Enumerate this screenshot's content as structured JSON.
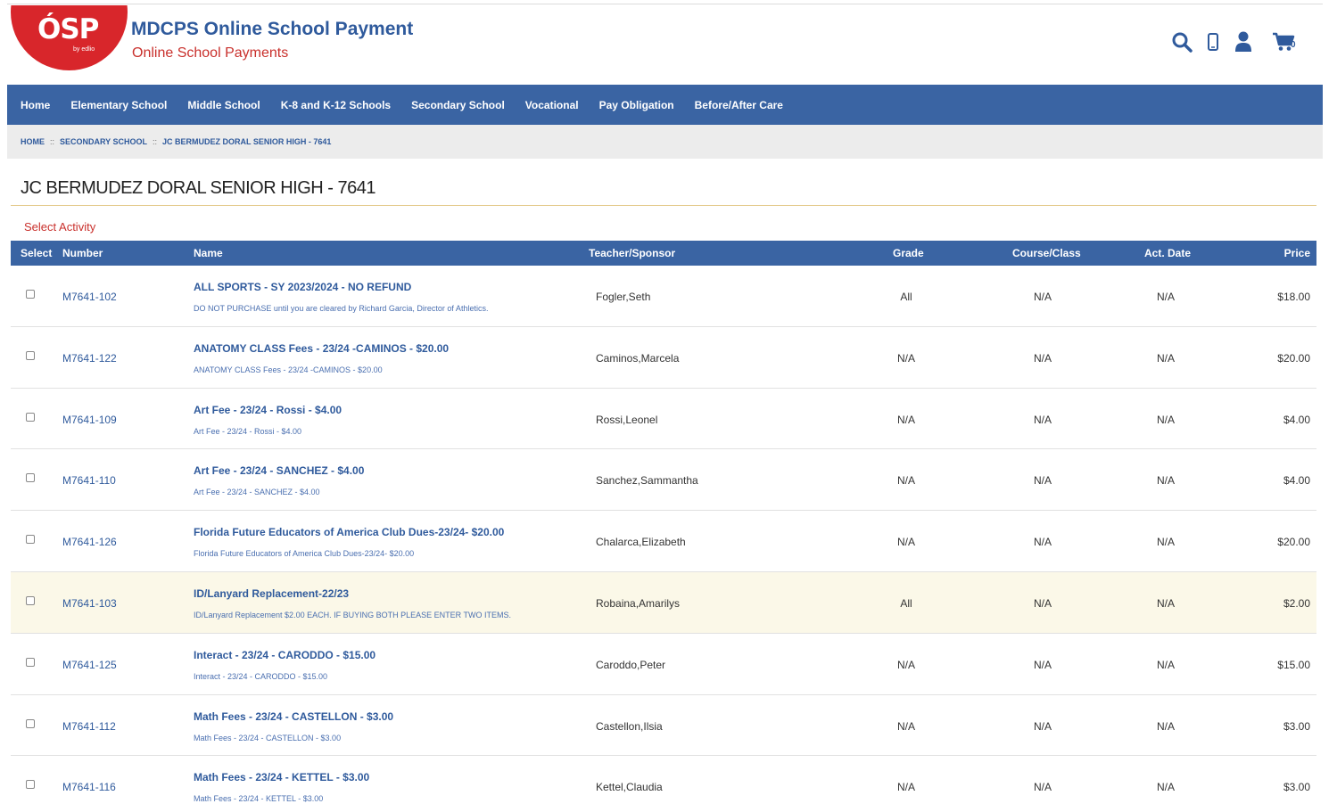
{
  "header": {
    "logo_text": "ÓSP",
    "logo_subtext": "by edlio",
    "title": "MDCPS Online School Payment",
    "subtitle": "Online School Payments",
    "cart_count": "0",
    "icons": [
      "search-icon",
      "phone-icon",
      "user-icon",
      "cart-icon"
    ]
  },
  "nav": {
    "items": [
      "Home",
      "Elementary School",
      "Middle School",
      "K-8 and K-12 Schools",
      "Secondary School",
      "Vocational",
      "Pay Obligation",
      "Before/After Care"
    ]
  },
  "breadcrumb": [
    "HOME",
    "SECONDARY SCHOOL",
    "JC BERMUDEZ DORAL SENIOR HIGH - 7641"
  ],
  "breadcrumb_separator": "::",
  "page_title": "JC BERMUDEZ DORAL SENIOR HIGH - 7641",
  "section_label": "Select Activity",
  "table": {
    "headers": [
      "Select",
      "Number",
      "Name",
      "Teacher/Sponsor",
      "Grade",
      "Course/Class",
      "Act. Date",
      "Price"
    ],
    "rows": [
      {
        "number": "M7641-102",
        "name": "ALL SPORTS - SY 2023/2024 - NO REFUND",
        "desc": "DO NOT PURCHASE until you are cleared by Richard Garcia, Director of Athletics.",
        "teacher": "Fogler,Seth",
        "grade": "All",
        "course": "N/A",
        "actdate": "N/A",
        "price": "$18.00"
      },
      {
        "number": "M7641-122",
        "name": "ANATOMY CLASS Fees - 23/24 -CAMINOS  - $20.00",
        "desc": "ANATOMY CLASS Fees - 23/24 -CAMINOS - $20.00",
        "teacher": "Caminos,Marcela",
        "grade": "N/A",
        "course": "N/A",
        "actdate": "N/A",
        "price": "$20.00"
      },
      {
        "number": "M7641-109",
        "name": "Art Fee - 23/24 - Rossi - $4.00",
        "desc": "Art Fee - 23/24 - Rossi - $4.00",
        "teacher": "Rossi,Leonel",
        "grade": "N/A",
        "course": "N/A",
        "actdate": "N/A",
        "price": "$4.00"
      },
      {
        "number": "M7641-110",
        "name": "Art Fee - 23/24 - SANCHEZ - $4.00",
        "desc": "Art Fee - 23/24 - SANCHEZ - $4.00",
        "teacher": "Sanchez,Sammantha",
        "grade": "N/A",
        "course": "N/A",
        "actdate": "N/A",
        "price": "$4.00"
      },
      {
        "number": "M7641-126",
        "name": "Florida Future Educators of America Club Dues-23/24- $20.00",
        "desc": "Florida Future Educators of America Club Dues-23/24- $20.00",
        "teacher": "Chalarca,Elizabeth",
        "grade": "N/A",
        "course": "N/A",
        "actdate": "N/A",
        "price": "$20.00"
      },
      {
        "number": "M7641-103",
        "name": "ID/Lanyard Replacement-22/23",
        "desc": "ID/Lanyard Replacement $2.00 EACH. IF BUYING BOTH PLEASE ENTER TWO ITEMS.",
        "teacher": "Robaina,Amarilys",
        "grade": "All",
        "course": "N/A",
        "actdate": "N/A",
        "price": "$2.00",
        "highlighted": true
      },
      {
        "number": "M7641-125",
        "name": "Interact - 23/24 - CARODDO - $15.00",
        "desc": "Interact - 23/24 - CARODDO - $15.00",
        "teacher": "Caroddo,Peter",
        "grade": "N/A",
        "course": "N/A",
        "actdate": "N/A",
        "price": "$15.00"
      },
      {
        "number": "M7641-112",
        "name": "Math Fees - 23/24 - CASTELLON - $3.00",
        "desc": "Math Fees - 23/24 - CASTELLON - $3.00",
        "teacher": "Castellon,Ilsia",
        "grade": "N/A",
        "course": "N/A",
        "actdate": "N/A",
        "price": "$3.00"
      },
      {
        "number": "M7641-116",
        "name": "Math Fees - 23/24 - KETTEL - $3.00",
        "desc": "Math Fees - 23/24 - KETTEL - $3.00",
        "teacher": "Kettel,Claudia",
        "grade": "N/A",
        "course": "N/A",
        "actdate": "N/A",
        "price": "$3.00"
      }
    ]
  },
  "colors": {
    "brand_blue": "#3a64a3",
    "link_blue": "#2f5a9c",
    "brand_red": "#d8262b",
    "accent_red": "#c9302c",
    "highlight_row": "#fbf8e8"
  }
}
